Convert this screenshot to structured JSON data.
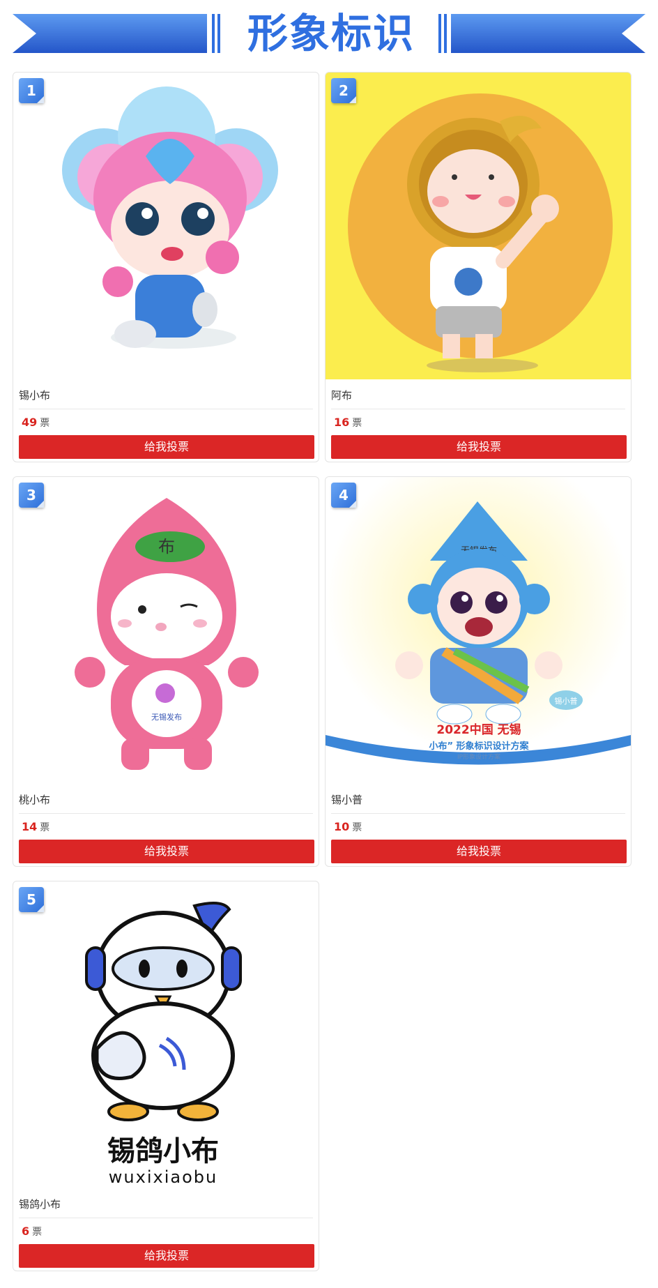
{
  "header": {
    "title": "形象标识"
  },
  "colors": {
    "accent_blue": "#2f6fe0",
    "vote_red": "#db2626",
    "badge_blue": "#2e6fd9"
  },
  "vote_unit": "票",
  "cards": [
    {
      "number": "1",
      "name": "锡小布",
      "votes": "49",
      "button": "给我投票"
    },
    {
      "number": "2",
      "name": "阿布",
      "votes": "16",
      "button": "给我投票"
    },
    {
      "number": "3",
      "name": "桃小布",
      "votes": "14",
      "button": "给我投票",
      "art_text": {
        "hat": "布",
        "belly": "无锡发布"
      }
    },
    {
      "number": "4",
      "name": "锡小普",
      "votes": "10",
      "button": "给我投票",
      "art_text": {
        "hat": "无锡发布",
        "tag": "锡小普",
        "line1": "2022中国 无锡",
        "line2": "小布” 形象标识设计方案",
        "line3": "IP形象设计方案"
      }
    },
    {
      "number": "5",
      "name": "锡鸽小布",
      "votes": "6",
      "button": "给我投票",
      "art_text": {
        "logo_cn": "锡鸽小布",
        "logo_en": "wuxixiaobu"
      }
    }
  ]
}
